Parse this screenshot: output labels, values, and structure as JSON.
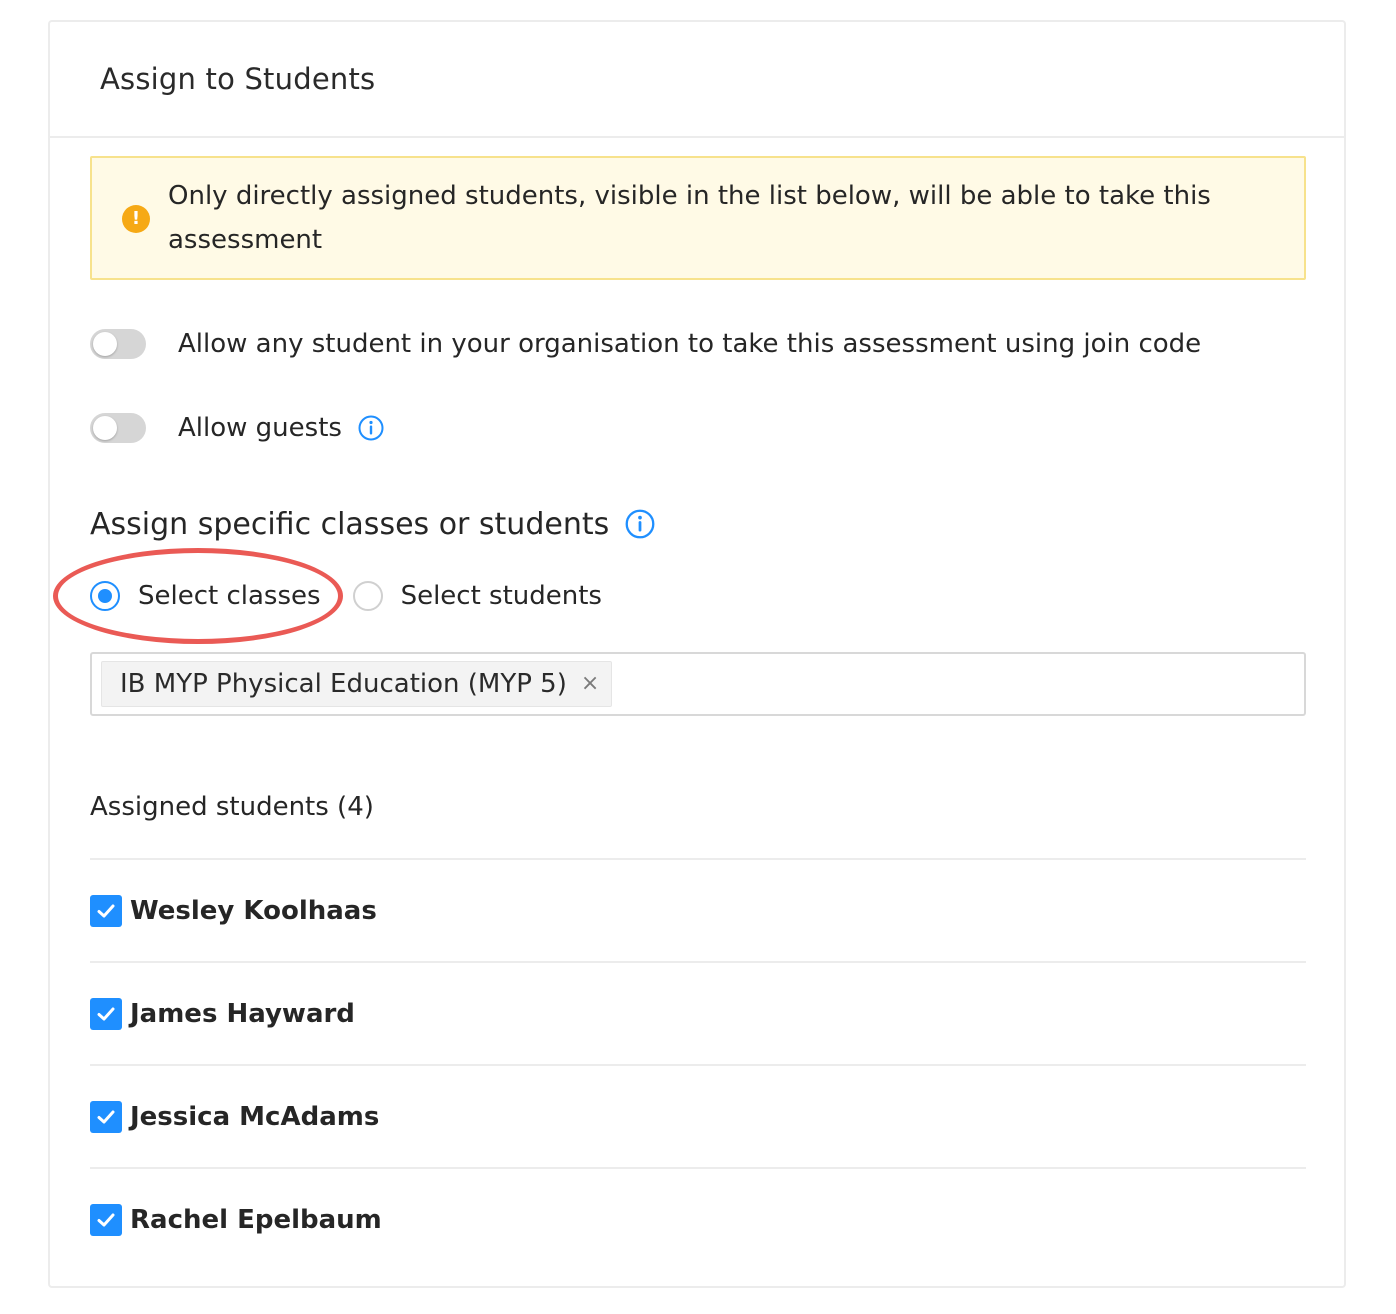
{
  "panel": {
    "title": "Assign to Students"
  },
  "alert": {
    "icon": "warning-circle-icon",
    "text": "Only directly assigned students, visible in the list below, will be able to take this assessment",
    "color": "#f6a915"
  },
  "toggles": {
    "join_code": {
      "label": "Allow any student in your organisation to take this assessment using join code",
      "enabled": false
    },
    "guests": {
      "label": "Allow guests",
      "enabled": false
    }
  },
  "assign_section": {
    "title": "Assign specific classes or students",
    "options": [
      {
        "label": "Select classes",
        "selected": true
      },
      {
        "label": "Select students",
        "selected": false
      }
    ]
  },
  "class_select": {
    "selected_tags": [
      {
        "label": "IB MYP Physical Education (MYP 5)",
        "remove_symbol": "×"
      }
    ]
  },
  "assigned": {
    "heading": "Assigned students (4)",
    "students": [
      {
        "name": "Wesley Koolhaas",
        "checked": true
      },
      {
        "name": "James Hayward",
        "checked": true
      },
      {
        "name": "Jessica McAdams",
        "checked": true
      },
      {
        "name": "Rachel Epelbaum",
        "checked": true
      }
    ]
  },
  "colors": {
    "accent": "#1f8fff",
    "highlight_annotation": "#ea5a55",
    "alert_background": "#fffae6"
  }
}
